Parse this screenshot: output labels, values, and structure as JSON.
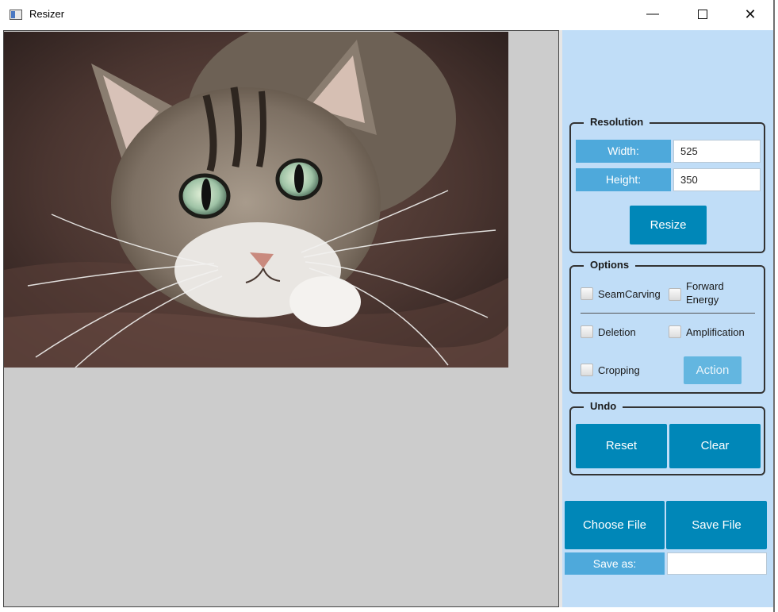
{
  "window": {
    "title": "Resizer",
    "icon": "app-window-icon",
    "minimize_glyph": "—",
    "close_glyph": "✕"
  },
  "resolution": {
    "legend": "Resolution",
    "width_label": "Width:",
    "width_value": "525",
    "height_label": "Height:",
    "height_value": "350",
    "resize_label": "Resize"
  },
  "options": {
    "legend": "Options",
    "seamcarving": "SeamCarving",
    "forward_energy": "Forward Energy",
    "deletion": "Deletion",
    "amplification": "Amplification",
    "cropping": "Cropping",
    "action": "Action"
  },
  "undo": {
    "legend": "Undo",
    "reset": "Reset",
    "clear": "Clear"
  },
  "file": {
    "choose": "Choose File",
    "save": "Save File",
    "save_as_label": "Save as:",
    "save_as_value": ""
  },
  "colors": {
    "panel_bg": "#c0ddf7",
    "button": "#0087b8",
    "label_cell": "#4ea9db",
    "canvas_bg": "#cccccc"
  }
}
